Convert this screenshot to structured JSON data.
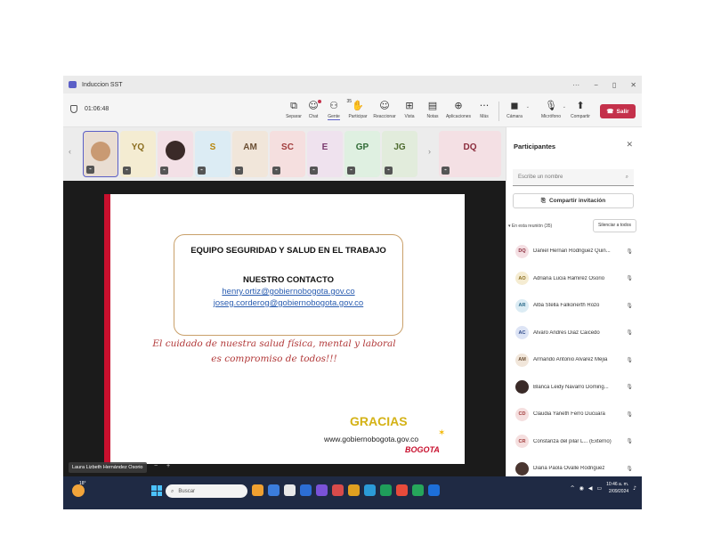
{
  "window": {
    "title": "Induccion SST",
    "controls": [
      "···",
      "−",
      "▯",
      "✕"
    ]
  },
  "toolbar": {
    "timer": "01:06:48",
    "buttons": [
      {
        "label": "Separar",
        "icon": "popout-icon",
        "glyph": "⧉"
      },
      {
        "label": "Chat",
        "icon": "chat-icon",
        "glyph": "☺"
      },
      {
        "label": "Gente",
        "icon": "people-icon",
        "glyph": "⚇",
        "count": "35"
      },
      {
        "label": "Participar",
        "icon": "raise-hand-icon",
        "glyph": "✋"
      },
      {
        "label": "Reaccionar",
        "icon": "react-icon",
        "glyph": "☺"
      },
      {
        "label": "Vista",
        "icon": "view-icon",
        "glyph": "⊞"
      },
      {
        "label": "Notas",
        "icon": "notes-icon",
        "glyph": "▤"
      },
      {
        "label": "Aplicaciones",
        "icon": "apps-icon",
        "glyph": "⊕"
      },
      {
        "label": "Más",
        "icon": "more-icon",
        "glyph": "···"
      },
      {
        "label": "Cámara",
        "icon": "camera-off-icon",
        "glyph": "◼"
      },
      {
        "label": "Micrófono",
        "icon": "mic-off-icon",
        "glyph": "🎙"
      },
      {
        "label": "Compartir",
        "icon": "share-icon",
        "glyph": "⬆"
      }
    ],
    "leave_label": "Salir",
    "leave_color": "#c4314b"
  },
  "strip": {
    "tiles": [
      {
        "initials": "",
        "bg": "#e9ddd2",
        "avatar": "photo",
        "photo": "#c99a73"
      },
      {
        "initials": "YQ",
        "bg": "#f4ecd2",
        "fg": "#8a6d1f"
      },
      {
        "initials": "",
        "bg": "#f3e0e6",
        "avatar": "photo",
        "photo": "#3a2a28"
      },
      {
        "initials": "S",
        "bg": "#dcecf4",
        "fg": "#b8860b"
      },
      {
        "initials": "AM",
        "bg": "#f1e6da",
        "fg": "#6b4f34"
      },
      {
        "initials": "SC",
        "bg": "#f5dfdf",
        "fg": "#a13c3c"
      },
      {
        "initials": "E",
        "bg": "#efe2ee",
        "fg": "#7a3b6e"
      },
      {
        "initials": "GP",
        "bg": "#dff0e1",
        "fg": "#2f6b35"
      },
      {
        "initials": "JG",
        "bg": "#e2ecdc",
        "fg": "#4e6b2f"
      },
      {
        "initials": "DQ",
        "bg": "#f4e0e4",
        "fg": "#8a2b3b"
      }
    ]
  },
  "slide": {
    "heading": "EQUIPO SEGURIDAD Y SALUD EN EL TRABAJO",
    "contact_title": "NUESTRO CONTACTO",
    "email1": "henry.ortiz@gobiernobogota.gov.co",
    "email2": "joseg.corderog@gobiernobogota.gov.co",
    "slogan_line1": "El cuidado de nuestra salud física, mental y laboral",
    "slogan_line2": "es compromiso de todos!!!",
    "thanks": "GRACIAS",
    "website": "www.gobiernobogota.gov.co",
    "logo_text": "BOGOTA"
  },
  "presenter": {
    "name": "Laura Lizbeth Hernández Osorio"
  },
  "panel": {
    "title": "Participantes",
    "search_placeholder": "Escribe un nombre",
    "invite_label": "Compartir invitación",
    "section_label": "▾ En esta reunión (35)",
    "mute_all_label": "Silenciar a todos",
    "participants": [
      {
        "initials": "DQ",
        "name": "Daniel Hernan Rodriguez Quin...",
        "bg": "#f4dfe3",
        "fg": "#8a2b3b"
      },
      {
        "initials": "AO",
        "name": "Adriana Lucia Ramirez Osorio",
        "bg": "#f5ecd2",
        "fg": "#8a6d1f"
      },
      {
        "initials": "AR",
        "name": "Alba Stella Falkonerth Rozo",
        "bg": "#dcecf4",
        "fg": "#2a6b8a"
      },
      {
        "initials": "AC",
        "name": "Alvaro Andres Diaz Caicedo",
        "bg": "#dde4f5",
        "fg": "#2f4a8a"
      },
      {
        "initials": "AM",
        "name": "Armando Antonio Alvarez Mejia",
        "bg": "#f1e6da",
        "fg": "#6b4f34"
      },
      {
        "initials": "",
        "name": "Blanca Leidy Navarro Doming...",
        "bg": "#3a2a28",
        "fg": "#ffffff"
      },
      {
        "initials": "CD",
        "name": "Claudia Yaneth Ferro Ducuara",
        "bg": "#f5dfdf",
        "fg": "#a13c3c"
      },
      {
        "initials": "CR",
        "name": "Constanza del pilar L... (Externo)",
        "bg": "#f5dfdf",
        "fg": "#a13c3c"
      },
      {
        "initials": "",
        "name": "Diana Paola Ovalle Rodriguez",
        "bg": "#4a3630",
        "fg": "#ffffff"
      }
    ]
  },
  "taskbar": {
    "temp": "18°",
    "search_label": "Buscar",
    "time": "10:46 a. m.",
    "date": "2/09/2024",
    "apps": [
      "#f0a030",
      "#3b7ddd",
      "#e8e8e8",
      "#2c6ed5",
      "#7a52d8",
      "#d84b4b",
      "#e0a020",
      "#2b9bd8",
      "#1f9e5a",
      "#e84b3b",
      "#26a65b",
      "#1d6fd8"
    ]
  }
}
